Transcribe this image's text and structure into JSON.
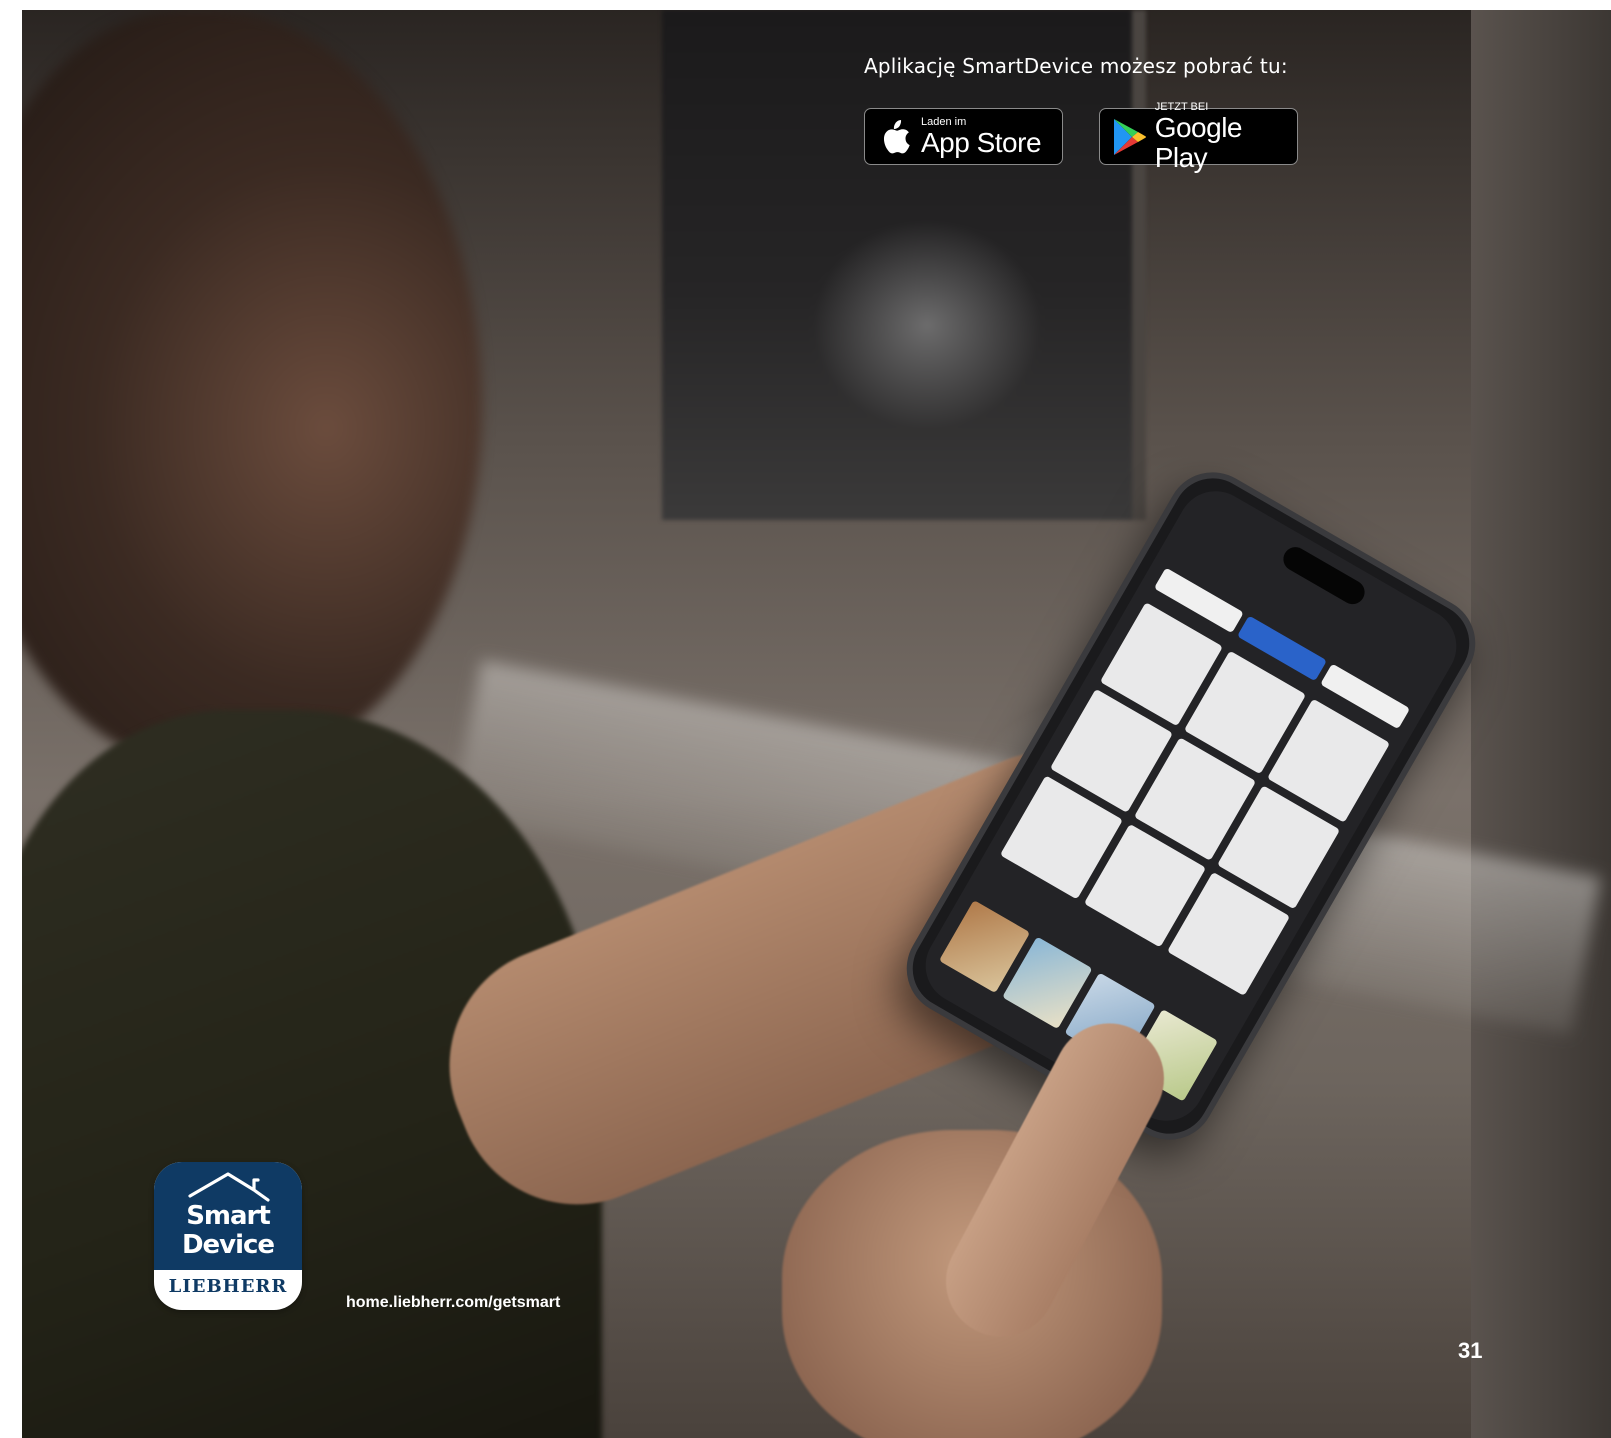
{
  "header": {
    "download_text": "Aplikację SmartDevice możesz pobrać tu:"
  },
  "badges": {
    "app_store": {
      "small": "Laden im",
      "big": "App Store",
      "icon": "apple-icon"
    },
    "google_play": {
      "small": "JETZT BEI",
      "big": "Google Play",
      "icon": "google-play-icon"
    }
  },
  "app_icon": {
    "line1": "Smart",
    "line2": "Device",
    "brand": "LIEBHERR",
    "color": "#0f3a64"
  },
  "footer": {
    "url": "home.liebherr.com/getsmart",
    "page_number": "31"
  }
}
